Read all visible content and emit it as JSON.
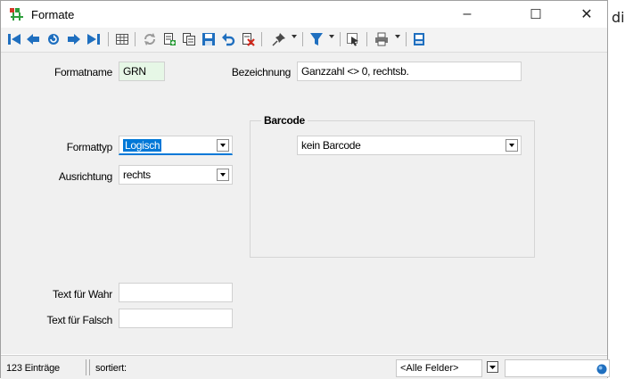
{
  "window": {
    "title": "Formate",
    "minimize": "–",
    "maximize": "☐",
    "close": "✕"
  },
  "outside_text": "di",
  "toolbar": {
    "icons": [
      "first-record-icon",
      "previous-record-icon",
      "refresh-icon",
      "next-record-icon",
      "last-record-icon",
      "table-view-icon",
      "reload-icon",
      "new-record-icon",
      "copy-record-icon",
      "save-icon",
      "undo-icon",
      "delete-icon",
      "pin-icon",
      "filter-icon",
      "cursor-icon",
      "print-icon",
      "layout-icon"
    ],
    "accent": "#1f6fbf"
  },
  "form": {
    "formatname_label": "Formatname",
    "formatname_value": "GRN",
    "bezeichnung_label": "Bezeichnung",
    "bezeichnung_value": "Ganzzahl <> 0, rechtsb.",
    "formattyp_label": "Formattyp",
    "formattyp_value": "Logisch",
    "ausrichtung_label": "Ausrichtung",
    "ausrichtung_value": "rechts",
    "barcode_group": "Barcode",
    "barcode_value": "kein Barcode",
    "wahr_label": "Text für Wahr",
    "wahr_value": "",
    "falsch_label": "Text für Falsch",
    "falsch_value": ""
  },
  "status": {
    "count": "123 Einträge",
    "sorted_label": "sortiert:",
    "field_select": "<Alle Felder>",
    "search_value": ""
  },
  "colors": {
    "green_field": "#e6f7e6",
    "selection": "#0078d7"
  }
}
